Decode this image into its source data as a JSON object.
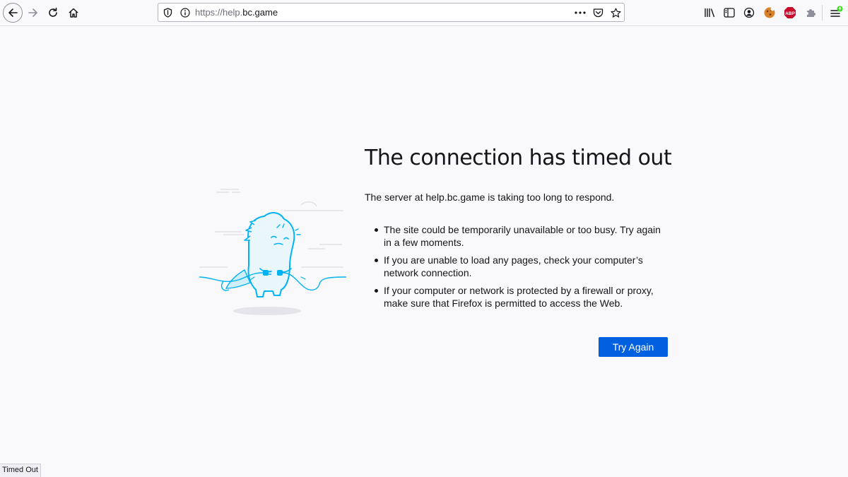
{
  "toolbar": {
    "back": "back-arrow-icon",
    "forward": "forward-arrow-icon",
    "reload": "reload-icon",
    "home": "home-icon",
    "url_prefix": "https://help.",
    "url_host": "bc.game",
    "right_icons": [
      "library-icon",
      "sidebar-icon",
      "account-icon",
      "cookie-extension-icon",
      "adblock-plus-icon",
      "puzzle-extension-icon",
      "menu-icon"
    ],
    "abp_label": "ABP"
  },
  "error": {
    "title": "The connection has timed out",
    "description": "The server at help.bc.game is taking too long to respond.",
    "reasons": [
      "The site could be temporarily unavailable or too busy. Try again in a few moments.",
      "If you are unable to load any pages, check your computer’s network connection.",
      "If your computer or network is protected by a firewall or proxy, make sure that Firefox is permitted to access the Web."
    ],
    "button_label": "Try Again"
  },
  "status": {
    "text": "Timed Out"
  },
  "colors": {
    "accent": "#0060df",
    "illustration": "#00b3f4",
    "background": "#f9f9fb"
  }
}
